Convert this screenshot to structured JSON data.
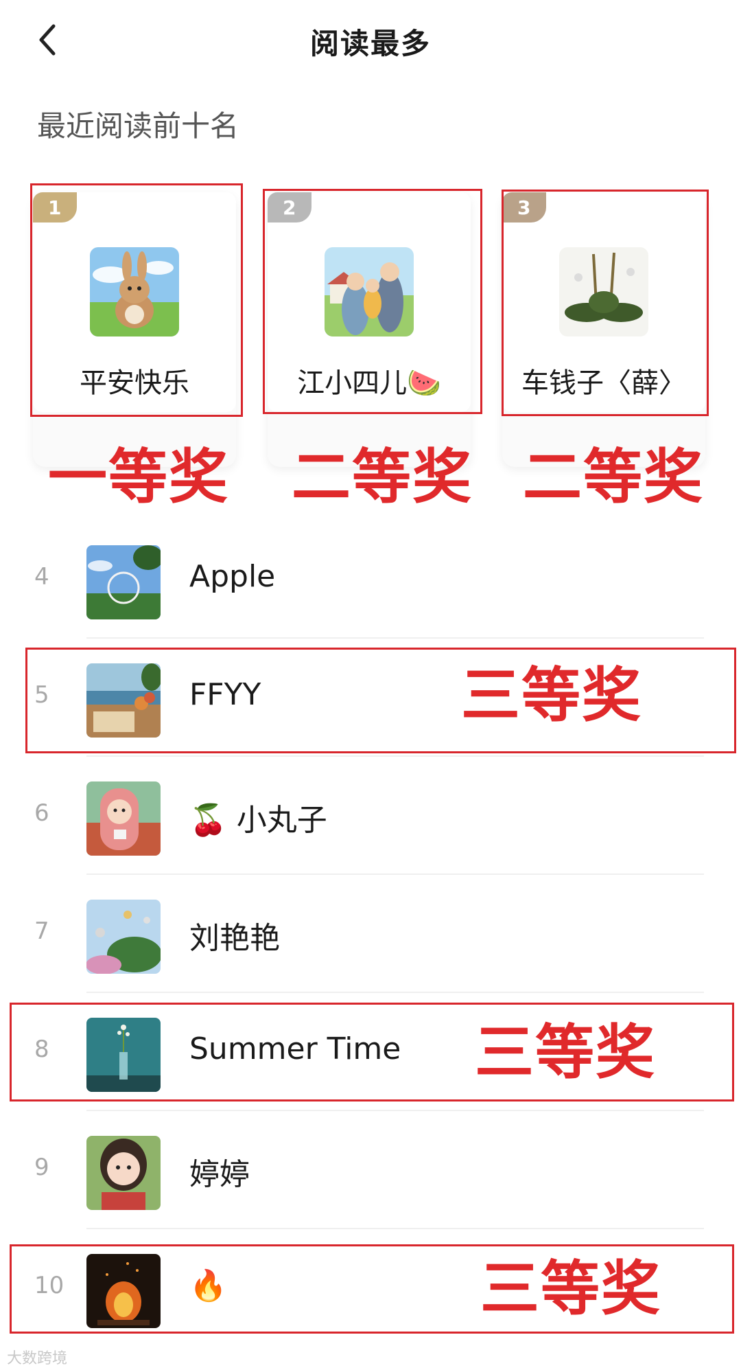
{
  "header": {
    "title": "阅读最多"
  },
  "subtitle": "最近阅读前十名",
  "top3": [
    {
      "rank": "1",
      "name": "平安快乐",
      "prize": "一等奖",
      "badge_color": "#c9b07c"
    },
    {
      "rank": "2",
      "name": "江小四儿🍉",
      "prize": "二等奖",
      "badge_color": "#b8b8b8"
    },
    {
      "rank": "3",
      "name": "车钱子〈薛〉",
      "prize": "二等奖",
      "badge_color": "#b9a289"
    }
  ],
  "list": [
    {
      "rank": "4",
      "name": "Apple",
      "prize": ""
    },
    {
      "rank": "5",
      "name": "FFYY",
      "prize": "三等奖"
    },
    {
      "rank": "6",
      "name": "🍒 小丸子",
      "prize": ""
    },
    {
      "rank": "7",
      "name": "刘艳艳",
      "prize": ""
    },
    {
      "rank": "8",
      "name": "Summer Time",
      "prize": "三等奖"
    },
    {
      "rank": "9",
      "name": "婷婷",
      "prize": ""
    },
    {
      "rank": "10",
      "name": "🔥",
      "prize": "三等奖"
    }
  ],
  "watermark": "大数跨境",
  "colors": {
    "annotation_red": "#e0292b",
    "rank_gray": "#a8a8a8"
  }
}
